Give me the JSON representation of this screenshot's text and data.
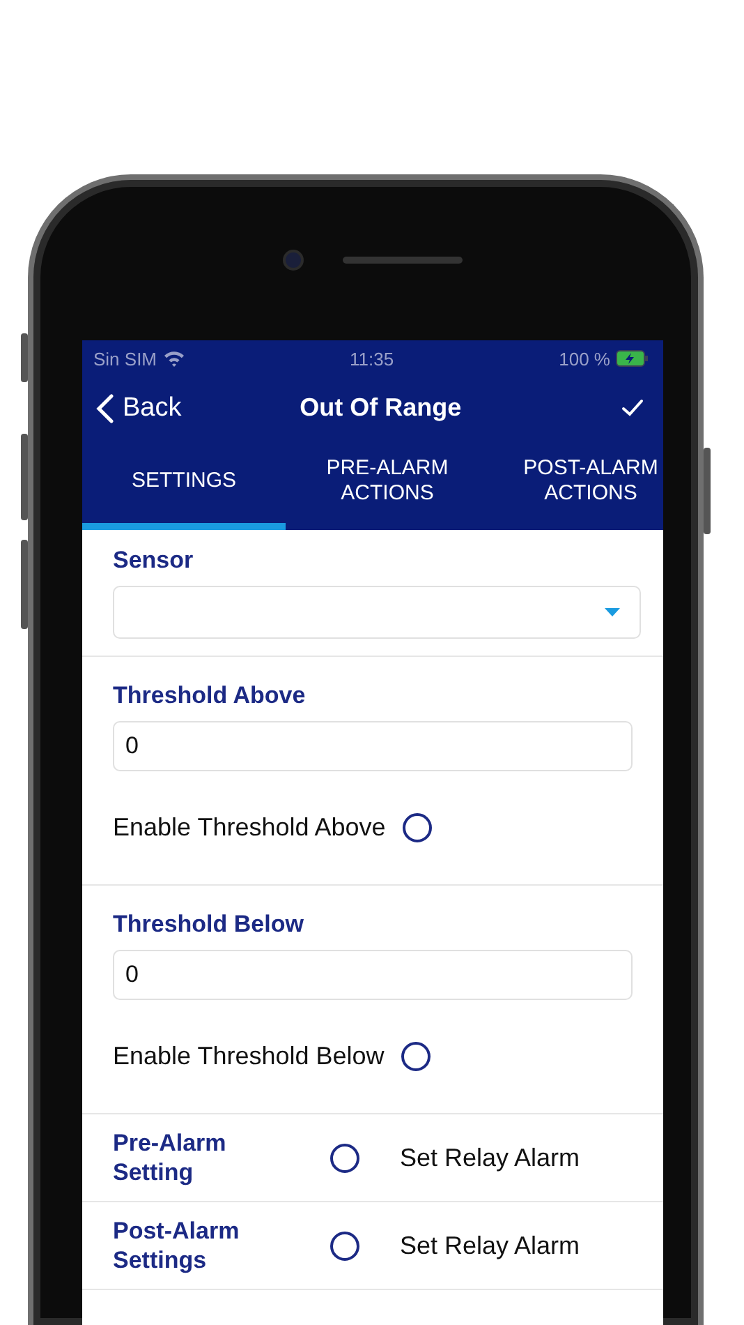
{
  "status_bar": {
    "carrier": "Sin SIM",
    "time": "11:35",
    "battery": "100 %"
  },
  "nav": {
    "back": "Back",
    "title": "Out Of Range"
  },
  "tabs": [
    {
      "label": "SETTINGS",
      "selected": true
    },
    {
      "label": "PRE-ALARM ACTIONS",
      "selected": false
    },
    {
      "label": "POST-ALARM ACTIONS",
      "selected": false
    }
  ],
  "sensor": {
    "label": "Sensor"
  },
  "thresholds": [
    {
      "label": "Threshold Above",
      "value": "0",
      "toggle": "Enable Threshold Above",
      "checked": false
    },
    {
      "label": "Threshold Below",
      "value": "0",
      "toggle": "Enable Threshold Below",
      "checked": false
    }
  ],
  "alarm_settings": [
    {
      "label": "Pre-Alarm Setting",
      "checked": false,
      "option": "Set Relay Alarm"
    },
    {
      "label": "Post-Alarm Settings",
      "checked": false,
      "option": "Set Relay Alarm"
    }
  ]
}
